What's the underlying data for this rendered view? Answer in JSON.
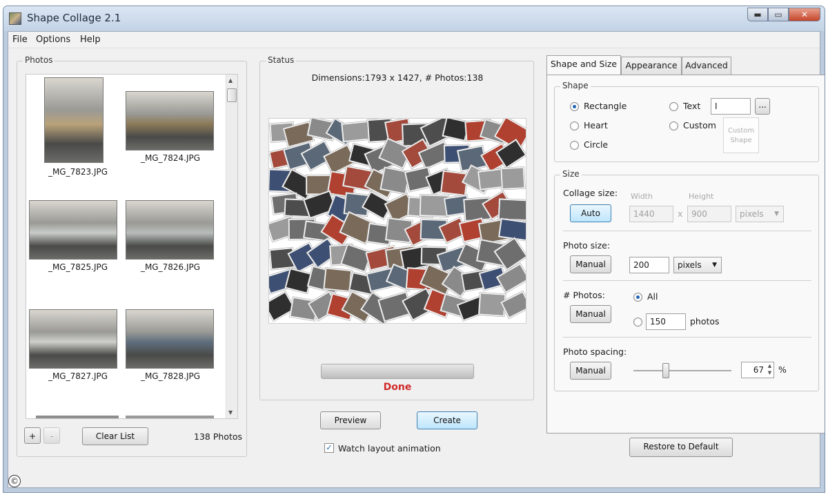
{
  "window": {
    "title": "Shape Collage 2.1",
    "min": "▬",
    "max": "▭",
    "close": "✕"
  },
  "menu": {
    "file": "File",
    "options": "Options",
    "help": "Help"
  },
  "photos": {
    "group_label": "Photos",
    "items": [
      {
        "name": "_MG_7823.JPG",
        "tone": "#b9a27a"
      },
      {
        "name": "_MG_7824.JPG",
        "tone": "#8d7b58"
      },
      {
        "name": "_MG_7825.JPG",
        "tone": "#c9ccc9"
      },
      {
        "name": "_MG_7826.JPG",
        "tone": "#b8bdbb"
      },
      {
        "name": "_MG_7827.JPG",
        "tone": "#cfcfcb"
      },
      {
        "name": "_MG_7828.JPG",
        "tone": "#5f6f7e"
      }
    ],
    "add": "+",
    "remove": "-",
    "clear_label": "Clear List",
    "count": "138 Photos"
  },
  "status": {
    "group_label": "Status",
    "dimensions": "Dimensions:1793 x 1427, # Photos:138",
    "done": "Done",
    "preview_label": "Preview",
    "create_label": "Create",
    "watch_label": "Watch layout animation",
    "progress": 1.0
  },
  "tabs": {
    "shape_size": "Shape and Size",
    "appearance": "Appearance",
    "advanced": "Advanced"
  },
  "shape": {
    "group_label": "Shape",
    "rectangle": "Rectangle",
    "heart": "Heart",
    "circle": "Circle",
    "text": "Text",
    "text_value": "I",
    "browse": "...",
    "custom": "Custom",
    "custom_shape_line1": "Custom",
    "custom_shape_line2": "Shape"
  },
  "size": {
    "group_label": "Size",
    "collage_label": "Collage size:",
    "auto_label": "Auto",
    "width_label": "Width",
    "height_label": "Height",
    "width_value": "1440",
    "x_sep": "x",
    "height_value": "900",
    "unit": "pixels",
    "photo_size_label": "Photo size:",
    "photo_manual": "Manual",
    "photo_size_value": "200",
    "photo_unit": "pixels",
    "nphotos_label": "# Photos:",
    "nphotos_manual": "Manual",
    "all_label": "All",
    "nphotos_value": "150",
    "photos_word": "photos",
    "spacing_label": "Photo spacing:",
    "spacing_manual": "Manual",
    "spacing_value": "67",
    "percent": "%"
  },
  "restore_label": "Restore to Default",
  "corner_badge": "©"
}
